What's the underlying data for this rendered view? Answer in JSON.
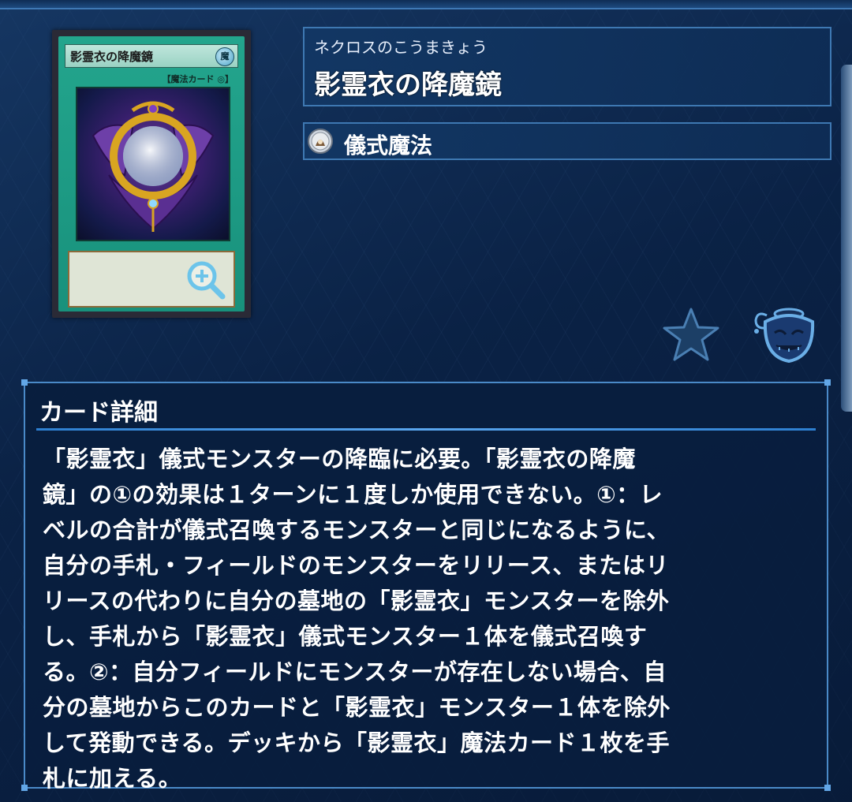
{
  "card": {
    "name_on_card": "影霊衣の降魔鏡",
    "type_line_on_card": "【魔法カード ◎】",
    "attribute_glyph": "魔"
  },
  "name_box": {
    "ruby": "ネクロスのこうまきょう",
    "name": "影霊衣の降魔鏡"
  },
  "type_box": {
    "icon": "ritual-spell-icon",
    "label": "儀式魔法"
  },
  "actions": {
    "favorite_icon": "star-icon",
    "related_icon": "pot-icon"
  },
  "detail": {
    "title": "カード詳細",
    "text": "「影霊衣」儀式モンスターの降臨に必要。「影霊衣の降魔\n鏡」の①の効果は１ターンに１度しか使用できない。①：レ\nベルの合計が儀式召喚するモンスターと同じになるように、\n自分の手札・フィールドのモンスターをリリース、またはリ\nリースの代わりに自分の墓地の「影霊衣」モンスターを除外\nし、手札から「影霊衣」儀式モンスター１体を儀式召喚す\nる。②：自分フィールドにモンスターが存在しない場合、自\n分の墓地からこのカードと「影霊衣」モンスター１体を除外\nして発動できる。デッキから「影霊衣」魔法カード１枚を手\n札に加える。"
  },
  "colors": {
    "background": "#0b2347",
    "panel_border": "#4a8ac8",
    "card_frame": "#1d9b86",
    "accent_rule": "#5aa6ee"
  }
}
